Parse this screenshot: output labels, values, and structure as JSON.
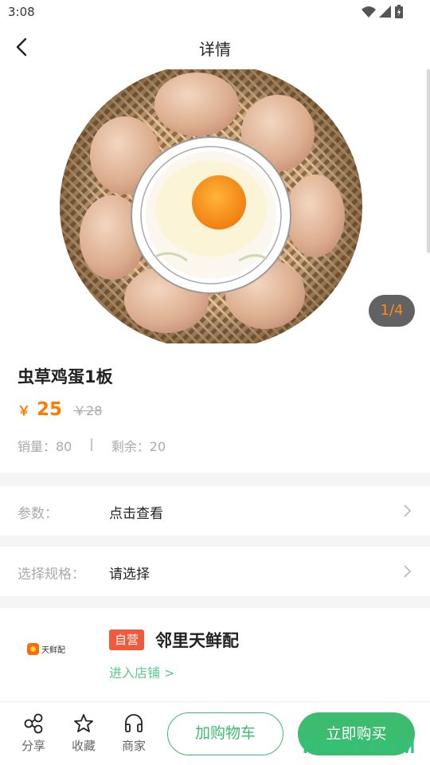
{
  "status_bar": {
    "time": "3:08"
  },
  "header": {
    "title": "详情"
  },
  "gallery": {
    "indicator": "1/4"
  },
  "product": {
    "title": "虫草鸡蛋1板",
    "currency": "￥",
    "price": "25",
    "original_price": "￥28",
    "sales": "销量：80",
    "separator": "|",
    "remaining": "剩余：20"
  },
  "params": {
    "label": "参数：",
    "value": "点击查看"
  },
  "spec": {
    "label": "选择规格：",
    "value": "请选择"
  },
  "store": {
    "logo_text": "天鲜配",
    "badge": "自营",
    "name": "邻里天鲜配",
    "link": "进入店铺 >"
  },
  "bottom_bar": {
    "share": "分享",
    "favorite": "收藏",
    "merchant": "商家",
    "add_cart": "加购物车",
    "buy_now": "立即购买"
  },
  "watermark": "ITMOP.COM",
  "colors": {
    "accent": "#3dbb6e",
    "price": "#ff7a00",
    "badge": "#f05a3c"
  }
}
